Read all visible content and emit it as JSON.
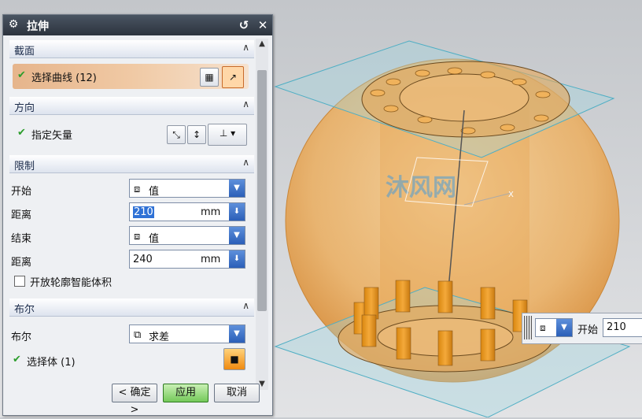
{
  "dialog": {
    "title": "拉伸",
    "sections": {
      "section": {
        "header": "截面",
        "select_curve_label": "选择曲线 (12)"
      },
      "direction": {
        "header": "方向",
        "vector_label": "指定矢量"
      },
      "limits": {
        "header": "限制",
        "start_label": "开始",
        "start_option": "值",
        "start_distance_label": "距离",
        "start_distance_value": "210",
        "start_distance_unit": "mm",
        "end_label": "结束",
        "end_option": "值",
        "end_distance_label": "距离",
        "end_distance_value": "240",
        "end_distance_unit": "mm",
        "open_profile_label": "开放轮廓智能体积",
        "open_profile_checked": false
      },
      "boolean": {
        "header": "布尔",
        "boolean_label": "布尔",
        "boolean_option": "求差",
        "select_body_label": "选择体 (1)"
      }
    },
    "buttons": {
      "ok": "< 确定 >",
      "apply": "应用",
      "cancel": "取消"
    }
  },
  "floating_input": {
    "label": "开始",
    "value": "210"
  },
  "watermark": "沐风网",
  "axis_label": "X",
  "colors": {
    "accent_orange": "#e89a3c",
    "plane_cyan": "#8fd3e0",
    "titlebar": "#333a44",
    "apply_green": "#74c95a"
  }
}
